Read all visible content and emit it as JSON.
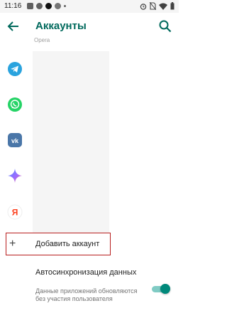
{
  "status_bar": {
    "time": "11:16"
  },
  "toolbar": {
    "title": "Аккаунты"
  },
  "accounts": {
    "partial_label": "Opera",
    "items": [
      {
        "icon": "telegram-icon",
        "color": "#2aa3de"
      },
      {
        "icon": "whatsapp-icon",
        "color": "#25d366"
      },
      {
        "icon": "vk-icon",
        "color": "#4a76a8"
      },
      {
        "icon": "gemini-icon",
        "color": "#7b61ff"
      },
      {
        "icon": "yandex-icon",
        "color": "#fc3f1d"
      }
    ]
  },
  "add_account": {
    "label": "Добавить аккаунт",
    "icon": "plus-icon"
  },
  "sync": {
    "title": "Автосинхронизация данных",
    "description": "Данные приложений обновляются без участия пользователя",
    "enabled": true
  },
  "colors": {
    "accent": "#00695c",
    "highlight_border": "#b71c1c",
    "switch_thumb": "#00897b"
  }
}
